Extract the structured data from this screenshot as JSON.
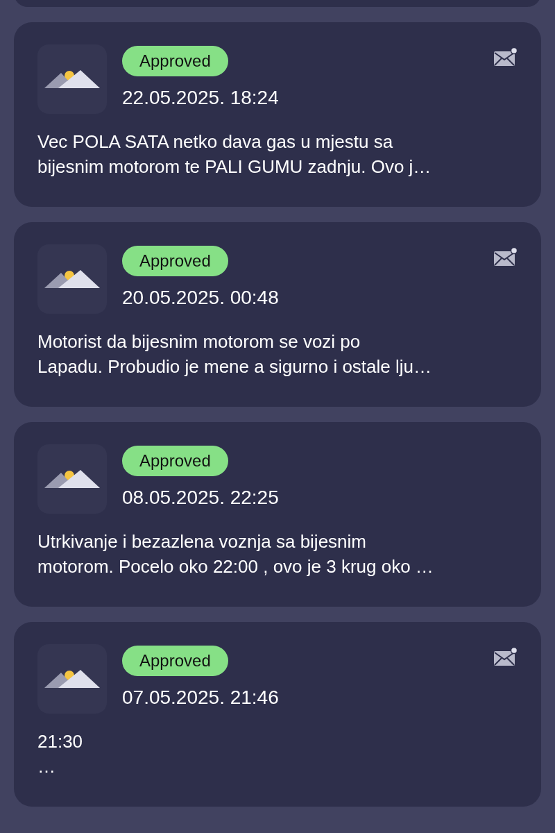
{
  "reports": [
    {
      "status": "Approved",
      "date": "22.05.2025. 18:24",
      "has_message": true,
      "description": "Vec POLA SATA netko dava gas u mjestu sa\nbijesnim motorom te PALI GUMU zadnju. Ovo j…"
    },
    {
      "status": "Approved",
      "date": "20.05.2025. 00:48",
      "has_message": true,
      "description": "Motorist da bijesnim motorom se vozi po\nLapadu. Probudio je mene a sigurno i ostale lju…"
    },
    {
      "status": "Approved",
      "date": "08.05.2025. 22:25",
      "has_message": false,
      "description": "Utrkivanje i bezazlena voznja sa bijesnim\nmotorom. Pocelo oko 22:00 , ovo je 3 krug oko …"
    },
    {
      "status": "Approved",
      "date": "07.05.2025. 21:46",
      "has_message": true,
      "description": "21:30\n…"
    }
  ]
}
